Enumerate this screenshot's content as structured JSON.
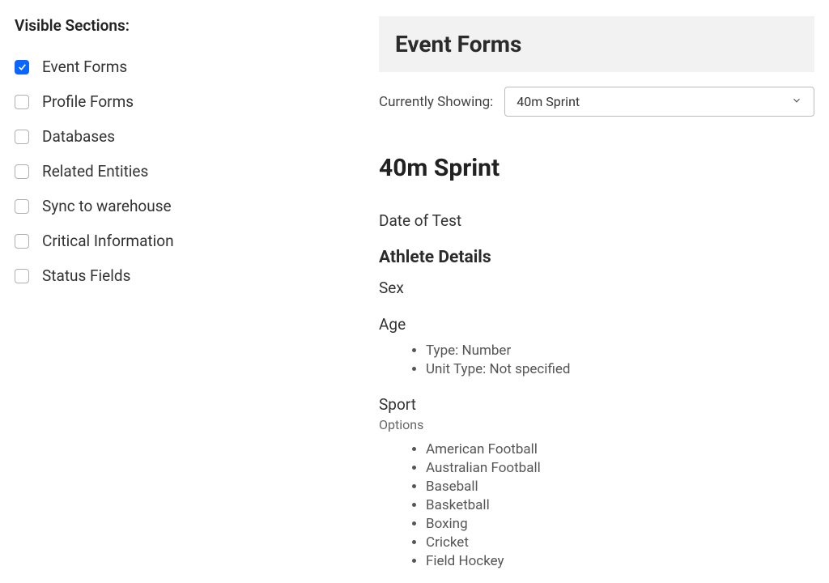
{
  "sidebar": {
    "title": "Visible Sections:",
    "items": [
      {
        "label": "Event Forms",
        "checked": true
      },
      {
        "label": "Profile Forms",
        "checked": false
      },
      {
        "label": "Databases",
        "checked": false
      },
      {
        "label": "Related Entities",
        "checked": false
      },
      {
        "label": "Sync to warehouse",
        "checked": false
      },
      {
        "label": "Critical Information",
        "checked": false
      },
      {
        "label": "Status Fields",
        "checked": false
      }
    ]
  },
  "main": {
    "section_header": "Event Forms",
    "select_label": "Currently Showing:",
    "select_value": "40m Sprint",
    "form_title": "40m Sprint",
    "field_date": "Date of Test",
    "athlete_details_title": "Athlete Details",
    "field_sex": "Sex",
    "field_age": "Age",
    "age_details": [
      "Type: Number",
      "Unit Type: Not specified"
    ],
    "field_sport": "Sport",
    "options_label": "Options",
    "sport_options": [
      "American Football",
      "Australian Football",
      "Baseball",
      "Basketball",
      "Boxing",
      "Cricket",
      "Field Hockey"
    ]
  }
}
